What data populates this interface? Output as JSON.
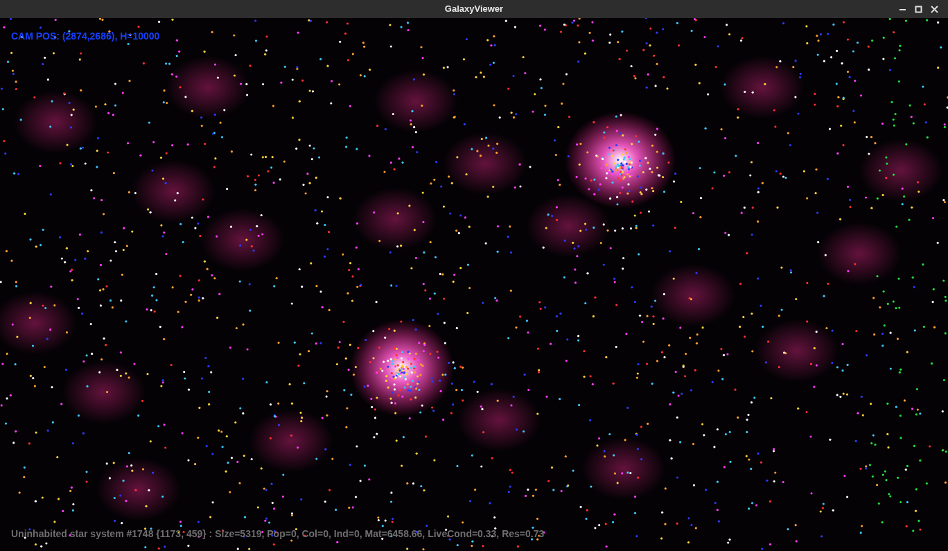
{
  "window": {
    "title": "GalaxyViewer"
  },
  "overlay": {
    "camera_info": "CAM POS: (2874,2686), H=10000",
    "selection_info": "Uninhabited star system #1748 {1173, 459} :  Size=5319, Pop=0, Col=0, Ind=0, Mat=6458.66, LiveCond=0.33, Res=0.73"
  }
}
